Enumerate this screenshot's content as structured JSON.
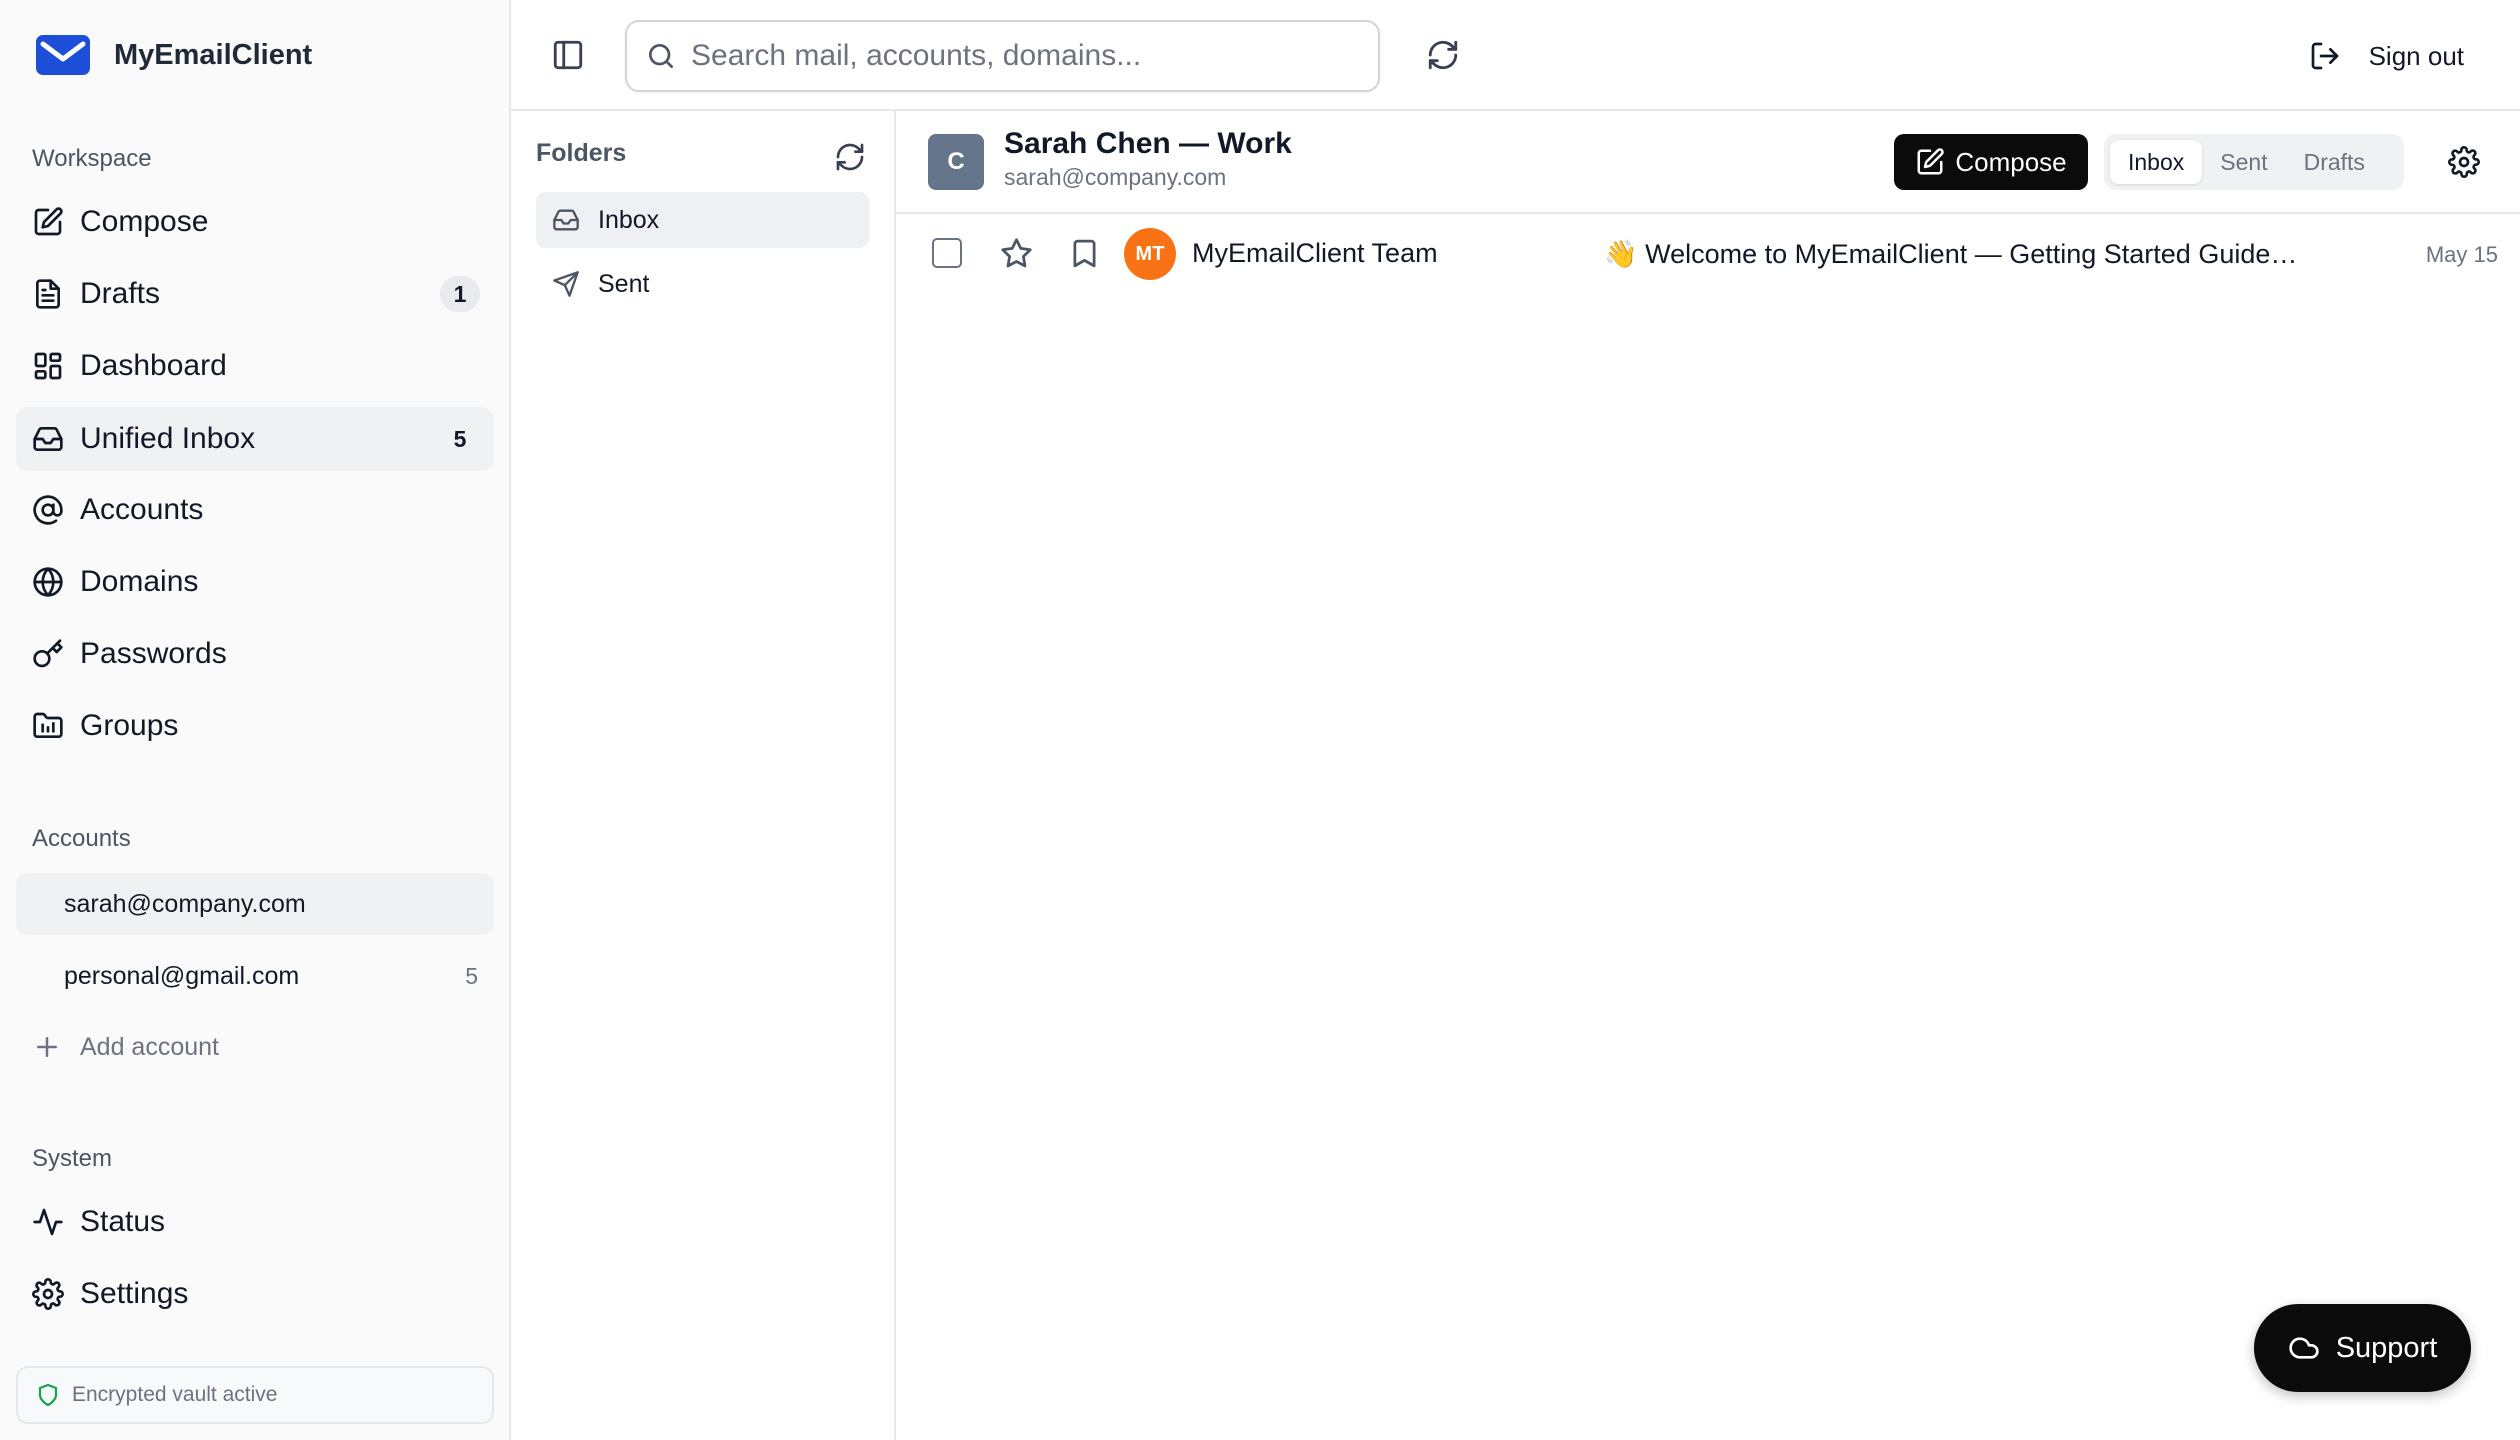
{
  "app": {
    "name": "MyEmailClient"
  },
  "sidebar": {
    "workspace_label": "Workspace",
    "nav": [
      {
        "label": "Compose",
        "icon": "compose-icon"
      },
      {
        "label": "Drafts",
        "icon": "document-icon",
        "count": "1"
      },
      {
        "label": "Dashboard",
        "icon": "dashboard-icon"
      },
      {
        "label": "Unified Inbox",
        "icon": "inbox-icon",
        "count": "5",
        "active": true
      },
      {
        "label": "Accounts",
        "icon": "at-icon"
      },
      {
        "label": "Domains",
        "icon": "globe-icon"
      },
      {
        "label": "Passwords",
        "icon": "key-icon"
      },
      {
        "label": "Groups",
        "icon": "groups-icon"
      }
    ],
    "accounts_label": "Accounts",
    "accounts": [
      {
        "email": "sarah@company.com",
        "active": true
      },
      {
        "email": "personal@gmail.com",
        "count": "5"
      }
    ],
    "add_account_label": "Add account",
    "system_label": "System",
    "system": [
      {
        "label": "Status",
        "icon": "activity-icon"
      },
      {
        "label": "Settings",
        "icon": "gear-icon"
      }
    ],
    "vault_status": "Encrypted vault active"
  },
  "topbar": {
    "search_placeholder": "Search mail, accounts, domains...",
    "sign_out_label": "Sign out"
  },
  "folders": {
    "title": "Folders",
    "items": [
      {
        "label": "Inbox",
        "icon": "inbox-icon",
        "active": true
      },
      {
        "label": "Sent",
        "icon": "send-icon"
      }
    ]
  },
  "account_header": {
    "avatar_initial": "C",
    "name": "Sarah Chen — Work",
    "email": "sarah@company.com",
    "compose_label": "Compose",
    "tabs": [
      {
        "label": "Inbox",
        "active": true
      },
      {
        "label": "Sent"
      },
      {
        "label": "Drafts"
      }
    ]
  },
  "messages": [
    {
      "avatar_initials": "MT",
      "sender": "MyEmailClient Team",
      "subject": "👋 Welcome to MyEmailClient — Getting Started Guide -...",
      "date": "May 15"
    }
  ],
  "support_label": "Support",
  "colors": {
    "accent": "#0b0b0b",
    "brand_blue": "#1d4ed8",
    "avatar_orange": "#f97316",
    "account_avatar": "#64748b",
    "vault_green": "#16a34a"
  }
}
